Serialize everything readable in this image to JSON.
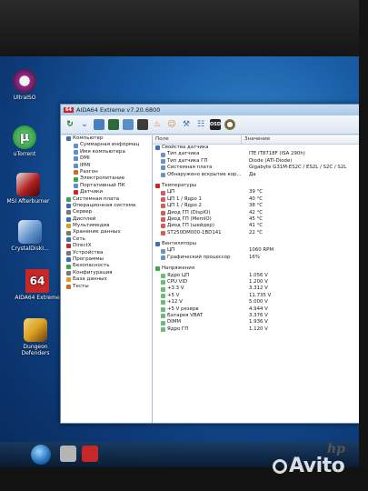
{
  "desktop": {
    "icons": [
      {
        "label": "UltraISO",
        "color": "#9b2c8a"
      },
      {
        "label": "uTorrent",
        "color": "#3aa64a"
      },
      {
        "label": "MSI Afterburner",
        "color": "#b01e1e"
      },
      {
        "label": "CrystalDiskI...",
        "color": "#5a8fc8"
      },
      {
        "label": "AIDA64 Extreme",
        "color": "#c62828",
        "badge": "64"
      },
      {
        "label": "Dungeon Defenders",
        "color": "#d8a020"
      }
    ],
    "watermark": "Avito",
    "monitor_brand": "hp"
  },
  "window": {
    "badge": "64",
    "title": "AIDA64 Extreme v7.20.6800",
    "toolbar": {
      "osd_label": "OSD"
    },
    "columns": {
      "field": "Поле",
      "value": "Значение"
    },
    "tree": [
      {
        "label": "Компьютер",
        "indent": 1,
        "color": "#3b6fb6"
      },
      {
        "label": "Суммарная информац",
        "indent": 2,
        "color": "#5a8fd0"
      },
      {
        "label": "Имя компьютера",
        "indent": 2,
        "color": "#5a8fd0"
      },
      {
        "label": "DMI",
        "indent": 2,
        "color": "#5a8fd0"
      },
      {
        "label": "IPMI",
        "indent": 2,
        "color": "#5a8fd0"
      },
      {
        "label": "Разгон",
        "indent": 2,
        "color": "#d26b1d"
      },
      {
        "label": "Электропитание",
        "indent": 2,
        "color": "#3aa64a"
      },
      {
        "label": "Портативный ПК",
        "indent": 2,
        "color": "#5a8fd0"
      },
      {
        "label": "Датчики",
        "indent": 2,
        "color": "#c62828"
      },
      {
        "label": "Системная плата",
        "indent": 1,
        "color": "#3aa64a"
      },
      {
        "label": "Операционная система",
        "indent": 1,
        "color": "#3b6fb6"
      },
      {
        "label": "Сервер",
        "indent": 1,
        "color": "#777777"
      },
      {
        "label": "Дисплей",
        "indent": 1,
        "color": "#3b6fb6"
      },
      {
        "label": "Мультимедиа",
        "indent": 1,
        "color": "#d8a020"
      },
      {
        "label": "Хранение данных",
        "indent": 1,
        "color": "#777777"
      },
      {
        "label": "Сеть",
        "indent": 1,
        "color": "#3b6fb6"
      },
      {
        "label": "DirectX",
        "indent": 1,
        "color": "#c62828"
      },
      {
        "label": "Устройства",
        "indent": 1,
        "color": "#777777"
      },
      {
        "label": "Программы",
        "indent": 1,
        "color": "#3b6fb6"
      },
      {
        "label": "Безопасность",
        "indent": 1,
        "color": "#3aa64a"
      },
      {
        "label": "Конфигурация",
        "indent": 1,
        "color": "#777777"
      },
      {
        "label": "База данных",
        "indent": 1,
        "color": "#d8a020"
      },
      {
        "label": "Тесты",
        "indent": 1,
        "color": "#d26b1d"
      }
    ],
    "sections": [
      {
        "title": "Свойства датчика",
        "color": "#3b6fb6",
        "rows": [
          {
            "field": "Тип датчика",
            "value": "ITE IT8718F (ISA 290h)"
          },
          {
            "field": "Тип датчика ГП",
            "value": "Diode (ATI-Diode)"
          },
          {
            "field": "Системная плата",
            "value": "Gigabyte G31M-ES2C / ES2L / S2C / S2L"
          },
          {
            "field": "Обнаружено вскрытие кор...",
            "value": "Да"
          }
        ]
      },
      {
        "title": "Температуры",
        "color": "#c62828",
        "rows": [
          {
            "field": "ЦП",
            "value": "39 °C"
          },
          {
            "field": "ЦП 1 / Ядро 1",
            "value": "40 °C"
          },
          {
            "field": "ЦП 1 / Ядро 2",
            "value": "38 °C"
          },
          {
            "field": "Диод ГП (DispIO)",
            "value": "42 °C"
          },
          {
            "field": "Диод ГП (MemIO)",
            "value": "45 °C"
          },
          {
            "field": "Диод ГП (шейдер)",
            "value": "41 °C"
          },
          {
            "field": "ST250DM000-1BD141",
            "value": "22 °C"
          }
        ]
      },
      {
        "title": "Вентиляторы",
        "color": "#3b6fb6",
        "rows": [
          {
            "field": "ЦП",
            "value": "1060 RPM"
          },
          {
            "field": "Графический процессор",
            "value": "16%"
          }
        ]
      },
      {
        "title": "Напряжения",
        "color": "#3aa64a",
        "rows": [
          {
            "field": "Ядро ЦП",
            "value": "1.056 V"
          },
          {
            "field": "CPU VID",
            "value": "1.200 V"
          },
          {
            "field": "+3.3 V",
            "value": "3.312 V"
          },
          {
            "field": "+5 V",
            "value": "11.735 V"
          },
          {
            "field": "+12 V",
            "value": "5.000 V"
          },
          {
            "field": "+5 V резерв",
            "value": "4.944 V"
          },
          {
            "field": "Батарея VBAT",
            "value": "3.376 V"
          },
          {
            "field": "DIMM",
            "value": "1.936 V"
          },
          {
            "field": "Ядро ГП",
            "value": "1.120 V"
          }
        ]
      }
    ]
  }
}
